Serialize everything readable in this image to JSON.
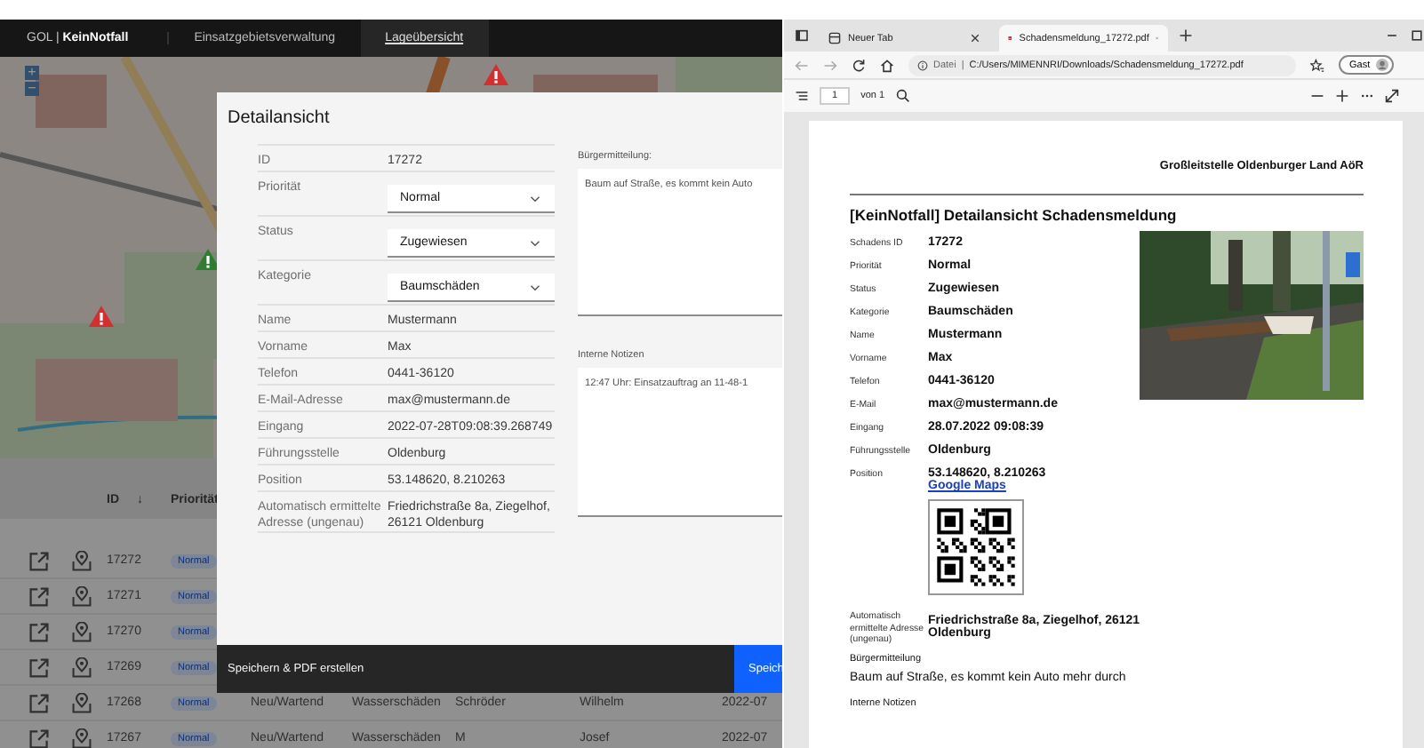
{
  "app": {
    "brand": "GOL |",
    "product": "KeinNotfall",
    "nav": [
      {
        "label": "Einsatzgebietsverwaltung",
        "selected": false
      },
      {
        "label": "Lageübersicht",
        "selected": true
      }
    ],
    "map": {
      "kind": "picture",
      "zoom_in": "+",
      "zoom_out": "−",
      "markers": [
        {
          "color": "#d32f2f"
        },
        {
          "color": "#2e7d32"
        },
        {
          "color": "#d32f2f"
        }
      ]
    },
    "table": {
      "columns": [
        {
          "label": "ID",
          "sort": "↓"
        },
        {
          "label": "Priorität"
        }
      ],
      "rows": [
        {
          "id": "17272",
          "priority": "Normal"
        },
        {
          "id": "17271",
          "priority": "Normal"
        },
        {
          "id": "17270",
          "priority": "Normal"
        },
        {
          "id": "17269",
          "priority": "Normal"
        },
        {
          "id": "17268",
          "priority": "Normal",
          "status": "Neu/Wartend",
          "category": "Wasserschäden",
          "name": "Schröder",
          "firstname": "Wilhelm",
          "received": "2022-07"
        },
        {
          "id": "17267",
          "priority": "Normal",
          "status": "Neu/Wartend",
          "category": "Wasserschäden",
          "name": "M",
          "firstname": "Josef",
          "received": "2022-07"
        }
      ]
    }
  },
  "modal": {
    "title": "Detailansicht",
    "fields": [
      {
        "kind": "text",
        "label": "ID",
        "value": "17272"
      },
      {
        "kind": "select",
        "label": "Priorität",
        "value": "Normal"
      },
      {
        "kind": "select",
        "label": "Status",
        "value": "Zugewiesen"
      },
      {
        "kind": "select",
        "label": "Kategorie",
        "value": "Baumschäden"
      },
      {
        "kind": "text",
        "label": "Name",
        "value": "Mustermann"
      },
      {
        "kind": "text",
        "label": "Vorname",
        "value": "Max"
      },
      {
        "kind": "text",
        "label": "Telefon",
        "value": "0441-36120"
      },
      {
        "kind": "text",
        "label": "E-Mail-Adresse",
        "value": "max@mustermann.de"
      },
      {
        "kind": "text",
        "label": "Eingang",
        "value": "2022-07-28T09:08:39.268749"
      },
      {
        "kind": "text",
        "label": "Führungsstelle",
        "value": "Oldenburg"
      },
      {
        "kind": "text",
        "label": "Position",
        "value": "53.148620, 8.210263"
      },
      {
        "kind": "text",
        "label": "Automatisch ermittelte Adresse (ungenau)",
        "value": "Friedrichstraße 8a, Ziegelhof, 26121 Oldenburg"
      }
    ],
    "message_label": "Bürgermitteilung:",
    "message": "Baum auf Straße, es kommt kein Auto",
    "notes_label": "Interne Notizen",
    "notes": "12:47 Uhr: Einsatzauftrag an 11-48-1",
    "footer_action": "Speichern & PDF erstellen",
    "footer_button": "Speich"
  },
  "browser": {
    "tabs": [
      {
        "title": "Neuer Tab",
        "selected": false
      },
      {
        "title": "Schadensmeldung_17272.pdf",
        "selected": true
      }
    ],
    "address": {
      "scheme": "Datei",
      "separator": "|",
      "url": "C:/Users/MIMENNRI/Downloads/Schadensmeldung_17272.pdf"
    },
    "profile": "Gast",
    "pdf_toolbar": {
      "page": "1",
      "of": "von 1"
    },
    "document": {
      "org": "Großleitstelle Oldenburger Land AöR",
      "title": "[KeinNotfall] Detailansicht Schadensmeldung",
      "fields": [
        {
          "label": "Schadens ID",
          "value": "17272"
        },
        {
          "label": "Priorität",
          "value": "Normal"
        },
        {
          "label": "Status",
          "value": "Zugewiesen"
        },
        {
          "label": "Kategorie",
          "value": "Baumschäden"
        },
        {
          "label": "Name",
          "value": "Mustermann"
        },
        {
          "label": "Vorname",
          "value": "Max"
        },
        {
          "label": "Telefon",
          "value": "0441-36120"
        },
        {
          "label": "E-Mail",
          "value": "max@mustermann.de"
        },
        {
          "label": "Eingang",
          "value": "28.07.2022 09:08:39"
        },
        {
          "label": "Führungsstelle",
          "value": "Oldenburg"
        },
        {
          "label": "Position",
          "value": "53.148620, 8.210263",
          "link": "Google Maps"
        }
      ],
      "address_label": "Automatisch ermittelte Adresse (ungenau)",
      "address": "Friedrichstraße 8a, Ziegelhof, 26121 Oldenburg",
      "message_label": "Bürgermitteilung",
      "message": "Baum auf Straße, es kommt kein Auto mehr durch",
      "notes_label": "Interne Notizen"
    }
  }
}
